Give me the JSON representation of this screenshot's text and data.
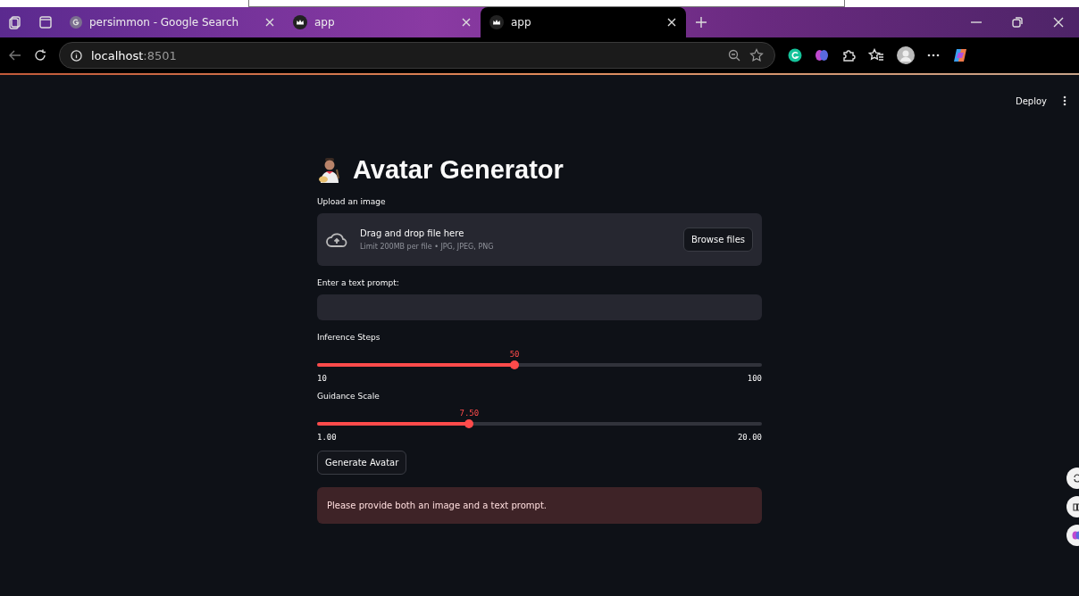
{
  "browser": {
    "tabs": [
      {
        "title": "persimmon - Google Search",
        "kind": "google",
        "selected": false
      },
      {
        "title": "app",
        "kind": "crown",
        "selected": false
      },
      {
        "title": "app",
        "kind": "crown",
        "selected": true
      }
    ],
    "address": {
      "host": "localhost",
      "port": ":8501"
    }
  },
  "app": {
    "header": {
      "deploy": "Deploy"
    },
    "title": "Avatar Generator",
    "uploader": {
      "label": "Upload an image",
      "drop_text": "Drag and drop file here",
      "limit_text": "Limit 200MB per file • JPG, JPEG, PNG",
      "button": "Browse files"
    },
    "prompt": {
      "label": "Enter a text prompt:"
    },
    "sliders": [
      {
        "label": "Inference Steps",
        "value_label": "50",
        "min_label": "10",
        "max_label": "100",
        "level": 0.444
      },
      {
        "label": "Guidance Scale",
        "value_label": "7.50",
        "min_label": "1.00",
        "max_label": "20.00",
        "level": 0.342
      }
    ],
    "button": "Generate Avatar",
    "alert": "Please provide both an image and a text prompt."
  }
}
